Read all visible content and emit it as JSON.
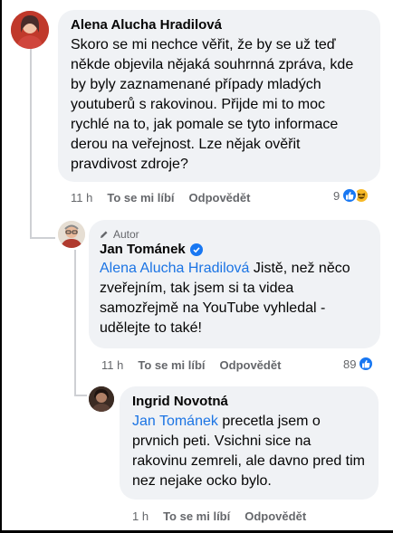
{
  "comments": [
    {
      "author": "Alena Alucha Hradilová",
      "text": "Skoro se mi nechce věřit, že by se už teď někde objevila nějaká souhrnná zpráva, kde by byly zaznamenané případy mladých youtuberů s rakovinou. Přijde mi to moc rychlé na to, jak pomale se tyto informace derou na veřejnost. Lze nějak ověřit pravdivost zdroje?",
      "time": "11 h",
      "like_label": "To se mi líbí",
      "reply_label": "Odpovědět",
      "reaction_count": "9",
      "reaction_icons": [
        "like-icon",
        "haha-icon"
      ]
    },
    {
      "badge": "Autor",
      "author": "Jan Tománek",
      "verified": true,
      "mention": "Alena Alucha Hradilová",
      "text": " Jistě, než něco zveřejním, tak jsem si ta videa samozřejmě na YouTube vyhledal - udělejte to také!",
      "time": "11 h",
      "like_label": "To se mi líbí",
      "reply_label": "Odpovědět",
      "reaction_count": "89",
      "reaction_icons": [
        "like-icon"
      ]
    },
    {
      "author": "Ingrid Novotná",
      "mention": "Jan Tománek",
      "text": " precetla jsem o prvnich peti. Vsichni sice na rakovinu zemreli, ale davno pred tim nez nejake ocko bylo.",
      "time": "1 h",
      "like_label": "To se mi líbí",
      "reply_label": "Odpovědět"
    }
  ],
  "colors": {
    "mention": "#1b74e4",
    "bubble": "#f0f2f5",
    "meta": "#65676b",
    "like": "#1877f2",
    "haha": "#f7b928"
  }
}
